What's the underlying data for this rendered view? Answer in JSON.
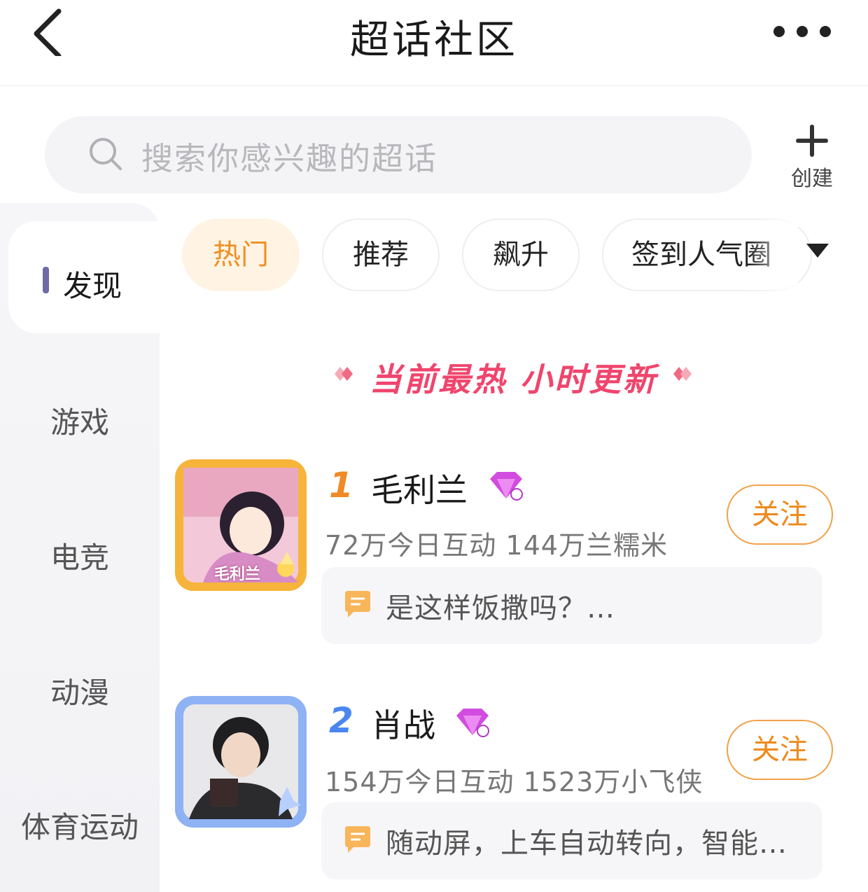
{
  "header": {
    "title": "超话社区",
    "back_icon": "chevron-left-icon",
    "more_icon": "more-dots-icon"
  },
  "search": {
    "placeholder": "搜索你感兴趣的超话",
    "create_label": "创建"
  },
  "sidebar": {
    "items": [
      {
        "label": "发现",
        "active": true
      },
      {
        "label": "游戏"
      },
      {
        "label": "电竞"
      },
      {
        "label": "动漫"
      },
      {
        "label": "体育运动"
      }
    ]
  },
  "tabs": [
    {
      "label": "热门",
      "active": true
    },
    {
      "label": "推荐"
    },
    {
      "label": "飙升"
    },
    {
      "label": "签到人气圈"
    }
  ],
  "banner": {
    "text": "当前最热 小时更新"
  },
  "ranking": [
    {
      "rank": "1",
      "name": "毛利兰",
      "stats": "72万今日互动 144万兰糯米",
      "follow_label": "关注",
      "latest_post": "是这样饭撒吗？…",
      "avatar_caption": "毛利兰"
    },
    {
      "rank": "2",
      "name": "肖战",
      "stats": "154万今日互动 1523万小飞侠",
      "follow_label": "关注",
      "latest_post": "随动屏，上车自动转向，智能…"
    }
  ],
  "colors": {
    "accent_orange": "#ee8a1c",
    "banner_pink": "#f0456d",
    "nav_marker": "#6f6aa6"
  }
}
